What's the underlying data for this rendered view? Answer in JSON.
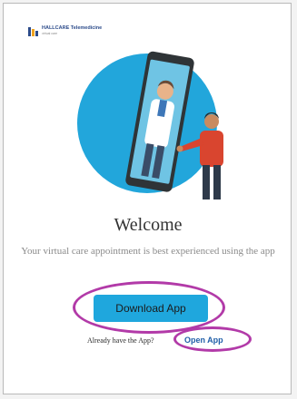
{
  "header": {
    "logo_text": "HALLCARE Telemedicine",
    "logo_sub": "virtual care"
  },
  "welcome": {
    "title": "Welcome",
    "subtitle": "Your virtual care appointment is best experienced using the app"
  },
  "actions": {
    "download_label": "Download App",
    "already_text": "Already have the App?",
    "open_label": "Open App"
  },
  "colors": {
    "accent": "#1fa7dd",
    "link": "#1f5ea8",
    "highlight": "#b23aa8"
  }
}
